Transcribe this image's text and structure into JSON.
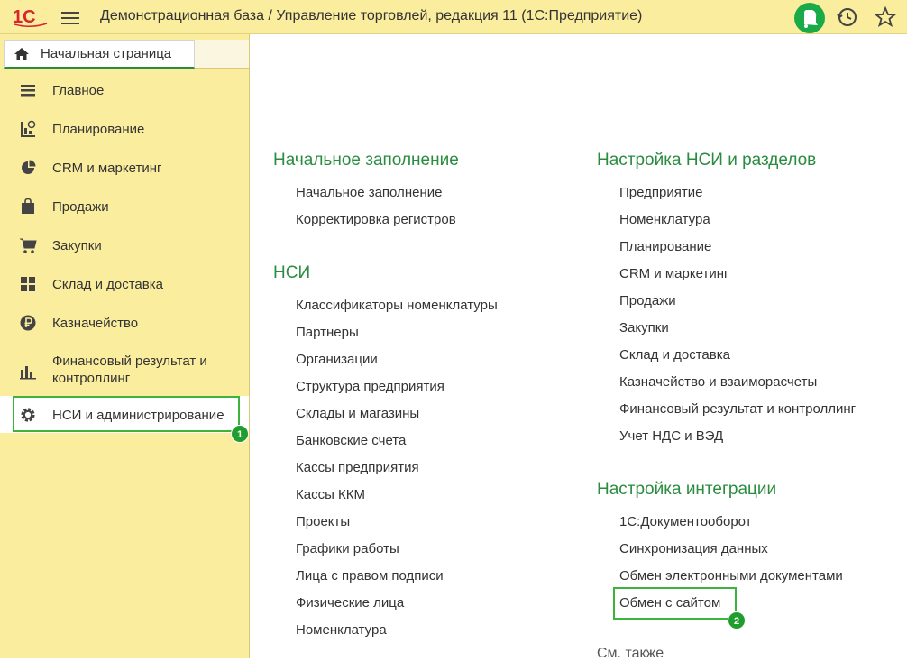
{
  "titlebar": {
    "logo_text": "1С",
    "title": "Демонстрационная база / Управление торговлей, редакция 11  (1С:Предприятие)",
    "icons": [
      "menu-icon",
      "bell-icon",
      "history-icon",
      "star-icon"
    ]
  },
  "sidebar": {
    "home_tab": "Начальная страница",
    "items": [
      {
        "label": "Главное",
        "icon": "list-icon"
      },
      {
        "label": "Планирование",
        "icon": "planning-icon"
      },
      {
        "label": "CRM и маркетинг",
        "icon": "pie-chart-icon"
      },
      {
        "label": "Продажи",
        "icon": "shopping-bag-icon"
      },
      {
        "label": "Закупки",
        "icon": "cart-icon"
      },
      {
        "label": "Склад и доставка",
        "icon": "warehouse-grid-icon"
      },
      {
        "label": "Казначейство",
        "icon": "ruble-icon"
      },
      {
        "label": "Финансовый результат и контроллинг",
        "icon": "bar-chart-icon"
      },
      {
        "label": "НСИ и администрирование",
        "icon": "gear-icon"
      }
    ],
    "active_badge": "1"
  },
  "main": {
    "left_column": [
      {
        "title": "Начальное заполнение",
        "links": [
          "Начальное заполнение",
          "Корректировка регистров"
        ]
      },
      {
        "title": "НСИ",
        "links": [
          "Классификаторы номенклатуры",
          "Партнеры",
          "Организации",
          "Структура предприятия",
          "Склады и магазины",
          "Банковские счета",
          "Кассы предприятия",
          "Кассы ККМ",
          "Проекты",
          "Графики работы",
          "Лица с правом подписи",
          "Физические лица",
          "Номенклатура"
        ]
      }
    ],
    "right_column": [
      {
        "title": "Настройка НСИ и разделов",
        "links": [
          "Предприятие",
          "Номенклатура",
          "Планирование",
          "CRM и маркетинг",
          "Продажи",
          "Закупки",
          "Склад и доставка",
          "Казначейство и взаиморасчеты",
          "Финансовый результат и контроллинг",
          "Учет НДС и ВЭД"
        ]
      },
      {
        "title": "Настройка интеграции",
        "links": [
          "1С:Документооборот",
          "Синхронизация данных",
          "Обмен электронными документами",
          "Обмен с сайтом"
        ]
      }
    ],
    "see_also": "См. также",
    "highlight_badge": "2"
  },
  "colors": {
    "accent_green": "#2a8c3f",
    "sidebar_bg": "#fbed9e",
    "highlight_green": "#3cb33c"
  }
}
